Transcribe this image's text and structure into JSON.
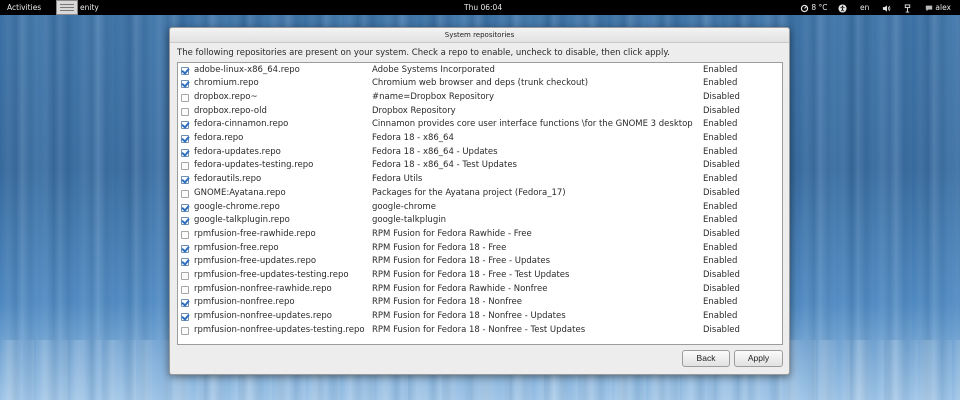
{
  "topbar": {
    "activities": "Activities",
    "app_name": "enity",
    "clock": "Thu 06:04",
    "weather": "8 °C",
    "language": "en",
    "user": "alex"
  },
  "dialog": {
    "title": "System repositories",
    "description": "The following repositories are present on your system. Check a repo to enable, uncheck to disable, then click apply.",
    "back_label": "Back",
    "apply_label": "Apply"
  },
  "repos": [
    {
      "checked": true,
      "name": "adobe-linux-x86_64.repo",
      "desc": "Adobe Systems Incorporated",
      "state": "Enabled"
    },
    {
      "checked": true,
      "name": "chromium.repo",
      "desc": "Chromium web browser and deps (trunk checkout)",
      "state": "Enabled"
    },
    {
      "checked": false,
      "name": "dropbox.repo~",
      "desc": "#name=Dropbox Repository",
      "state": "Disabled"
    },
    {
      "checked": false,
      "name": "dropbox.repo-old",
      "desc": "Dropbox Repository",
      "state": "Disabled"
    },
    {
      "checked": true,
      "name": "fedora-cinnamon.repo",
      "desc": "Cinnamon provides core user interface functions \\for the GNOME 3 desktop",
      "state": "Enabled"
    },
    {
      "checked": true,
      "name": "fedora.repo",
      "desc": "Fedora 18 - x86_64",
      "state": "Enabled"
    },
    {
      "checked": true,
      "name": "fedora-updates.repo",
      "desc": "Fedora 18 - x86_64 - Updates",
      "state": "Enabled"
    },
    {
      "checked": false,
      "name": "fedora-updates-testing.repo",
      "desc": "Fedora 18 - x86_64 - Test Updates",
      "state": "Disabled"
    },
    {
      "checked": true,
      "name": "fedorautils.repo",
      "desc": "Fedora Utils",
      "state": "Enabled"
    },
    {
      "checked": false,
      "name": "GNOME:Ayatana.repo",
      "desc": "Packages for the Ayatana project (Fedora_17)",
      "state": "Disabled"
    },
    {
      "checked": true,
      "name": "google-chrome.repo",
      "desc": "google-chrome",
      "state": "Enabled"
    },
    {
      "checked": true,
      "name": "google-talkplugin.repo",
      "desc": "google-talkplugin",
      "state": "Enabled"
    },
    {
      "checked": false,
      "name": "rpmfusion-free-rawhide.repo",
      "desc": "RPM Fusion for Fedora Rawhide - Free",
      "state": "Disabled"
    },
    {
      "checked": true,
      "name": "rpmfusion-free.repo",
      "desc": "RPM Fusion for Fedora 18 - Free",
      "state": "Enabled"
    },
    {
      "checked": true,
      "name": "rpmfusion-free-updates.repo",
      "desc": "RPM Fusion for Fedora 18 - Free - Updates",
      "state": "Enabled"
    },
    {
      "checked": false,
      "name": "rpmfusion-free-updates-testing.repo",
      "desc": "RPM Fusion for Fedora 18 - Free - Test Updates",
      "state": "Disabled"
    },
    {
      "checked": false,
      "name": "rpmfusion-nonfree-rawhide.repo",
      "desc": "RPM Fusion for Fedora Rawhide - Nonfree",
      "state": "Disabled"
    },
    {
      "checked": true,
      "name": "rpmfusion-nonfree.repo",
      "desc": "RPM Fusion for Fedora 18 - Nonfree",
      "state": "Enabled"
    },
    {
      "checked": true,
      "name": "rpmfusion-nonfree-updates.repo",
      "desc": "RPM Fusion for Fedora 18 - Nonfree - Updates",
      "state": "Enabled"
    },
    {
      "checked": false,
      "name": "rpmfusion-nonfree-updates-testing.repo",
      "desc": "RPM Fusion for Fedora 18 - Nonfree - Test Updates",
      "state": "Disabled"
    }
  ]
}
